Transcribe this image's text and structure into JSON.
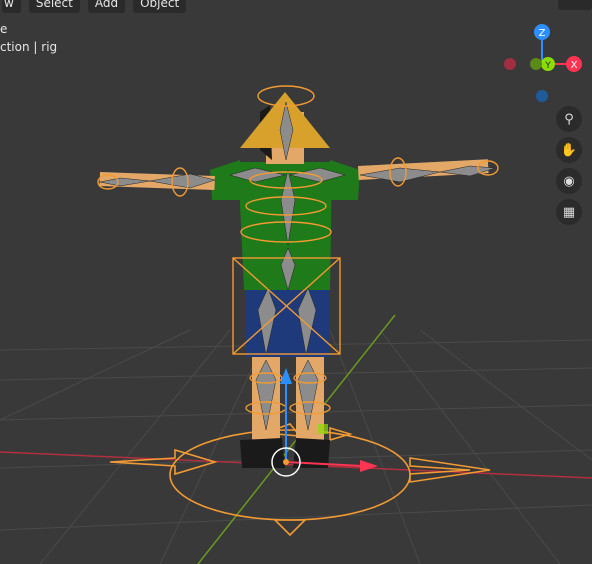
{
  "header_menu": {
    "items": [
      "w",
      "Select",
      "Add",
      "Object"
    ]
  },
  "viewport_info": {
    "mode_line": "e",
    "collection_line": "ction | rig"
  },
  "gizmo": {
    "z_label": "Z",
    "y_label": "Y",
    "x_label": "X"
  },
  "nav_buttons": [
    "zoom-icon",
    "pan-hand-icon",
    "camera-icon",
    "grid-icon"
  ],
  "colors": {
    "background": "#393939",
    "selection_outline": "#f29a33",
    "axis_x": "#ff3352",
    "axis_y": "#8bdc00",
    "axis_z": "#2c8fff",
    "bone": "#8c8c8c",
    "shirt": "#1f7a1a",
    "shorts": "#1f3a7a",
    "skin": "#e3a867",
    "hat": "#d8a12c"
  }
}
